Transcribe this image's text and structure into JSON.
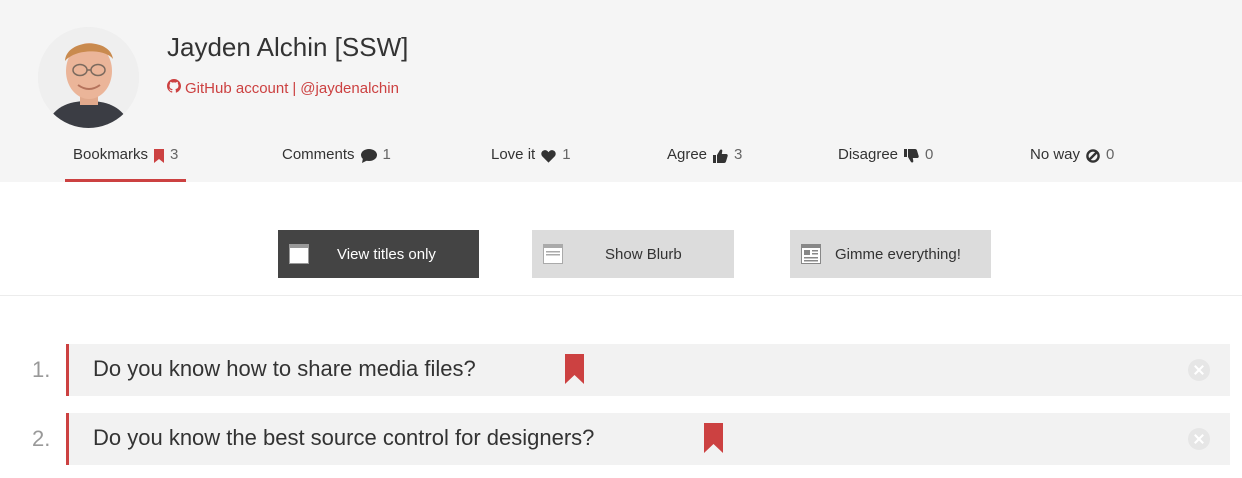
{
  "profile": {
    "name": "Jayden Alchin [SSW]",
    "github_link": "GitHub account",
    "separator": "|",
    "handle": "@jaydenalchin"
  },
  "tabs": [
    {
      "label": "Bookmarks",
      "count": "3",
      "icon": "bookmark-icon"
    },
    {
      "label": "Comments",
      "count": "1",
      "icon": "comment-icon"
    },
    {
      "label": "Love it",
      "count": "1",
      "icon": "heart-icon"
    },
    {
      "label": "Agree",
      "count": "3",
      "icon": "thumbs-up-icon"
    },
    {
      "label": "Disagree",
      "count": "0",
      "icon": "thumbs-down-icon"
    },
    {
      "label": "No way",
      "count": "0",
      "icon": "ban-icon"
    }
  ],
  "view_modes": [
    {
      "label": "View titles only",
      "selected": true
    },
    {
      "label": "Show Blurb",
      "selected": false
    },
    {
      "label": "Gimme everything!",
      "selected": false
    }
  ],
  "bookmarks": [
    {
      "number": "1.",
      "title": "Do you know how to share media files?"
    },
    {
      "number": "2.",
      "title": "Do you know the best source control for designers?"
    }
  ],
  "colors": {
    "accent": "#cc4141",
    "header_bg": "#f5f5f5",
    "active_button": "#444444"
  }
}
